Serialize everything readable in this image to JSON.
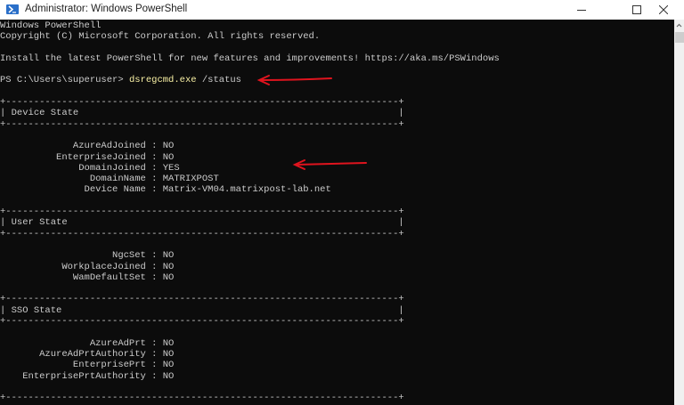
{
  "window": {
    "title": "Administrator: Windows PowerShell",
    "minimize_icon": "minimize-icon",
    "maximize_icon": "maximize-icon",
    "close_icon": "close-icon"
  },
  "terminal": {
    "header_lines": [
      "Windows PowerShell",
      "Copyright (C) Microsoft Corporation. All rights reserved.",
      "",
      "Install the latest PowerShell for new features and improvements! https://aka.ms/PSWindows",
      ""
    ],
    "prompt": "PS C:\\Users\\superuser> ",
    "command": "dsregcmd.exe",
    "command_args": " /status",
    "sections": [
      {
        "title": "Device State",
        "fields": [
          {
            "key": "AzureAdJoined",
            "value": "NO"
          },
          {
            "key": "EnterpriseJoined",
            "value": "NO"
          },
          {
            "key": "DomainJoined",
            "value": "YES"
          },
          {
            "key": "DomainName",
            "value": "MATRIXPOST"
          },
          {
            "key": "Device Name",
            "value": "Matrix-VM04.matrixpost-lab.net"
          }
        ]
      },
      {
        "title": "User State",
        "fields": [
          {
            "key": "NgcSet",
            "value": "NO"
          },
          {
            "key": "WorkplaceJoined",
            "value": "NO"
          },
          {
            "key": "WamDefaultSet",
            "value": "NO"
          }
        ]
      },
      {
        "title": "SSO State",
        "fields": [
          {
            "key": "AzureAdPrt",
            "value": "NO"
          },
          {
            "key": "AzureAdPrtAuthority",
            "value": "NO"
          },
          {
            "key": "EnterprisePrt",
            "value": "NO"
          },
          {
            "key": "EnterprisePrtAuthority",
            "value": "NO"
          }
        ]
      }
    ]
  },
  "colors": {
    "background": "#0c0c0c",
    "text": "#cccccc",
    "command": "#f9f1a5",
    "annotation_arrow": "#e0141e"
  }
}
